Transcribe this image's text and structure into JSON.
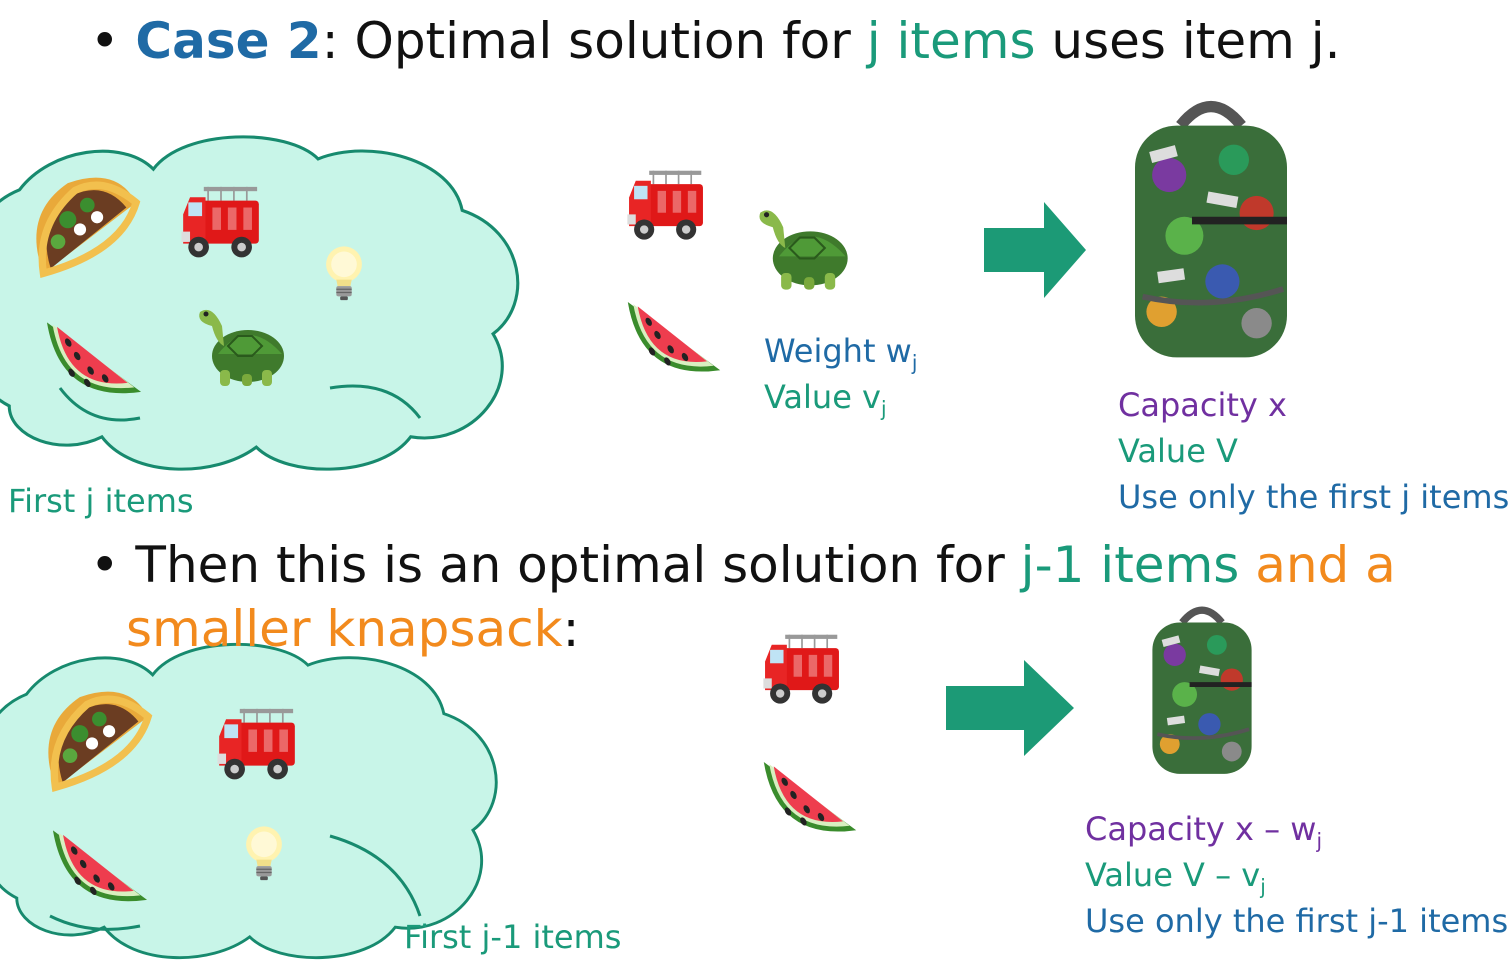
{
  "case_line": {
    "bullet": "•",
    "case_label": "Case 2",
    "colon": ":  Optimal solution for ",
    "j_items": "j items",
    "rest": " uses item j."
  },
  "top": {
    "cloud_label": "First j items",
    "item_weight": "Weight w",
    "item_weight_sub": "j",
    "item_value": "Value v",
    "item_value_sub": "j",
    "bag_capacity": "Capacity x",
    "bag_value": "Value V",
    "bag_rule": "Use only the first j items"
  },
  "then_line": {
    "bullet": "•",
    "text1": "Then this is an optimal solution for ",
    "j1_items": "j-1 items",
    "and_a": " and a",
    "smaller": "smaller knapsack",
    "colon": ":"
  },
  "bottom": {
    "cloud_label": "First j-1 items",
    "bag_capacity": "Capacity x – w",
    "bag_capacity_sub": "j",
    "bag_value": "Value V – v",
    "bag_value_sub": "j",
    "bag_rule": "Use only the first j-1 items."
  },
  "colors": {
    "cloud_fill": "#c8f5e8",
    "cloud_stroke": "#178a6e",
    "arrow": "#1c9a76",
    "blue": "#1f6aa5",
    "teal": "#1a9a7a",
    "orange": "#f28a1d",
    "purple": "#7030a0"
  },
  "icons": [
    "taco-icon",
    "fire-truck-icon",
    "lightbulb-icon",
    "watermelon-icon",
    "turtle-icon",
    "backpack-icon",
    "right-arrow-icon"
  ]
}
